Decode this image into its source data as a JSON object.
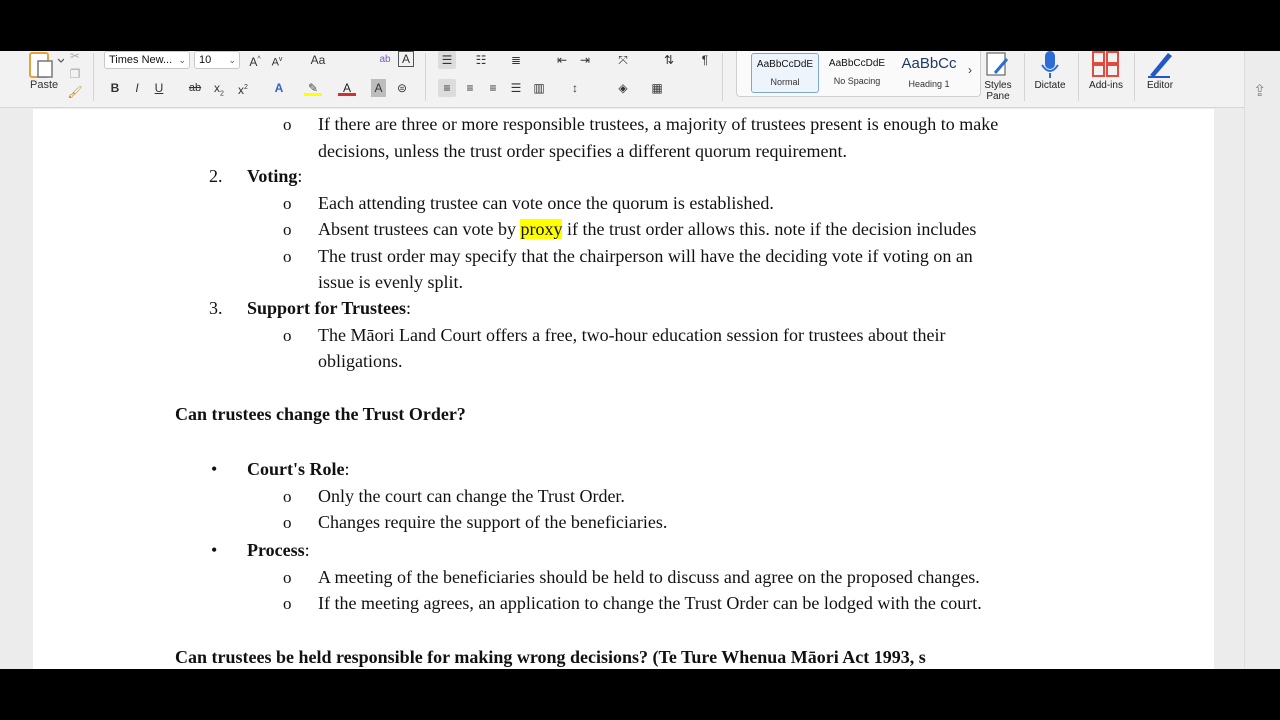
{
  "ribbon": {
    "paste_label": "Paste",
    "font_name": "Times New...",
    "font_size": "10",
    "styles": [
      {
        "preview": "AaBbCcDdE",
        "name": "Normal"
      },
      {
        "preview": "AaBbCcDdE",
        "name": "No Spacing"
      },
      {
        "preview": "AaBbCc",
        "name": "Heading 1"
      }
    ],
    "styles_pane_label": "Styles Pane",
    "dictate_label": "Dictate",
    "addins_label": "Add-ins",
    "editor_label": "Editor",
    "buttons": {
      "grow": "A",
      "shrink": "A",
      "case": "Aa",
      "bold": "B",
      "italic": "I",
      "underline": "U",
      "strike": "ab",
      "subscript": "x",
      "superscript": "x",
      "text_effects": "A",
      "font_color": "A",
      "char_shading": "A",
      "pilcrow": "¶"
    }
  },
  "document": {
    "list1_item_a_line1": "If there are three or more responsible trustees, a majority of trustees present is enough to make",
    "list1_item_a_line2": "decisions, unless the trust order specifies a different quorum requirement.",
    "voting_num": "2.",
    "voting_label": "Voting",
    "voting_colon": ":",
    "voting_items": {
      "a": "Each attending trustee can vote once the quorum is established.",
      "b_pre": "Absent trustees can vote by ",
      "b_hl": "proxy",
      "b_post": " if the trust order allows this. note if the decision includes",
      "c_line1": "The trust order may specify that the chairperson will have the deciding vote if voting on an",
      "c_line2": "issue is evenly split."
    },
    "support_num": "3.",
    "support_label": "Support for Trustees",
    "support_colon": ":",
    "support_item_line1": "The Māori Land Court offers a free, two-hour education session for trustees about their",
    "support_item_line2": "obligations.",
    "heading_change": "Can trustees change the Trust Order?",
    "courts_role_label": "Court's Role",
    "courts_role_colon": ":",
    "courts_items": [
      "Only the court can change the Trust Order.",
      "Changes require the support of the beneficiaries."
    ],
    "process_label": "Process",
    "process_colon": ":",
    "process_items": [
      "A meeting of the beneficiaries should be held to discuss and agree on the proposed changes.",
      "If the meeting agrees, an application to change the Trust Order can be lodged with the court."
    ],
    "heading_responsible": "Can trustees be held responsible for making wrong decisions? (Te Ture Whenua Māori Act 1993, s",
    "sub_bullet": "o",
    "dot_bullet": "•"
  },
  "colors": {
    "highlight": "#ffff00",
    "addins_red": "#e04a3f",
    "dictate_blue": "#2b6cd6",
    "editor_blue": "#2357c5"
  }
}
